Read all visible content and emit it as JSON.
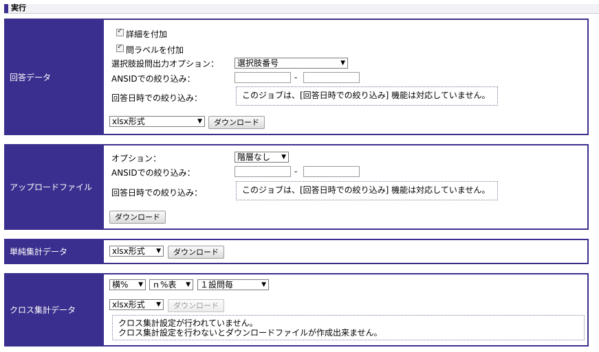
{
  "header": {
    "title": "実行"
  },
  "kaitou": {
    "label": "回答データ",
    "detail_checkbox_label": "詳細を付加",
    "question_label_checkbox_label": "問ラベルを付加",
    "choice_option_label": "選択肢設問出力オプション：",
    "choice_option_value": "選択肢番号",
    "ansid_label": "ANSIDでの絞り込み：",
    "ansid_separator": "-",
    "date_label": "回答日時での絞り込み：",
    "date_note": "このジョブは、[回答日時での絞り込み] 機能は対応していません。",
    "format_value": "xlsx形式",
    "download_label": "ダウンロード"
  },
  "upload": {
    "label": "アップロードファイル",
    "option_label": "オプション：",
    "option_value": "階層なし",
    "ansid_label": "ANSIDでの絞り込み：",
    "ansid_separator": "-",
    "date_label": "回答日時での絞り込み：",
    "date_note": "このジョブは、[回答日時での絞り込み] 機能は対応していません。",
    "download_label": "ダウンロード"
  },
  "simple": {
    "label": "単純集計データ",
    "format_value": "xlsx形式",
    "download_label": "ダウンロード"
  },
  "cross": {
    "label": "クロス集計データ",
    "percent_value": "横%",
    "n_value": "ｎ%表",
    "per_question_value": "１設問毎",
    "format_value": "xlsx形式",
    "download_label": "ダウンロード",
    "note_line1": "クロス集計設定が行われていません。",
    "note_line2": "クロス集計設定を行わないとダウンロードファイルが作成出来ません。"
  }
}
